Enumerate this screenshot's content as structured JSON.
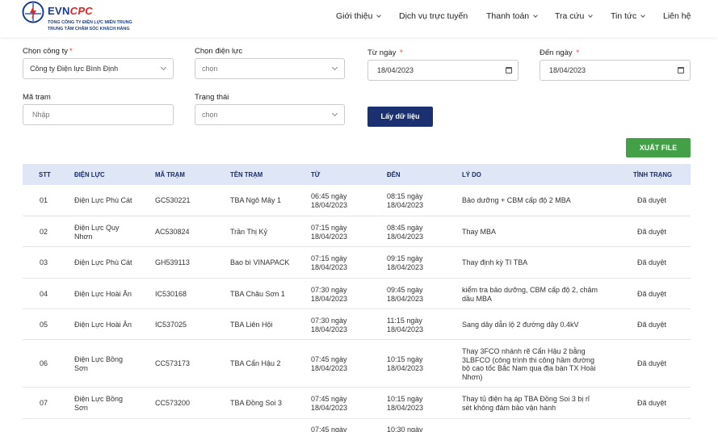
{
  "header": {
    "brand_evn": "EVN",
    "brand_cpc": "CPC",
    "line1": "TỔNG CÔNG TY ĐIỆN LỰC MIỀN TRUNG",
    "line2": "TRUNG TÂM CHĂM SÓC KHÁCH HÀNG",
    "nav": [
      {
        "label": "Giới thiệu",
        "dropdown": true
      },
      {
        "label": "Dịch vụ trực tuyến",
        "dropdown": false
      },
      {
        "label": "Thanh toán",
        "dropdown": true
      },
      {
        "label": "Tra cứu",
        "dropdown": true
      },
      {
        "label": "Tin tức",
        "dropdown": true
      },
      {
        "label": "Liên hệ",
        "dropdown": false
      }
    ]
  },
  "filters": {
    "company_label": "Chọn công ty",
    "company_value": "Công ty Điện lực Bình Định",
    "branch_label": "Chọn điện lực",
    "branch_value": "chọn",
    "from_label": "Từ ngày",
    "from_value": "18/04/2023",
    "to_label": "Đến ngày",
    "to_value": "18/04/2023",
    "station_label": "Mã trạm",
    "station_placeholder": "Nhập",
    "status_label": "Trạng thái",
    "status_value": "chọn",
    "get_button": "Lấy dữ liệu",
    "export_button": "XUẤT FILE"
  },
  "table": {
    "headers": [
      "STT",
      "ĐIỆN LỰC",
      "MÃ TRẠM",
      "TÊN TRẠM",
      "TỪ",
      "ĐẾN",
      "LÝ DO",
      "TÌNH TRẠNG"
    ],
    "rows": [
      {
        "stt": "01",
        "dl": [
          "Điện Lực Phù Cát"
        ],
        "ma": "GC530221",
        "ten": "TBA Ngô Mây 1",
        "tu": [
          "06:45 ngày",
          "18/04/2023"
        ],
        "den": [
          "08:15 ngày",
          "18/04/2023"
        ],
        "ly": [
          "Bảo dưỡng + CBM cấp độ 2 MBA"
        ],
        "tt": "Đã duyệt"
      },
      {
        "stt": "02",
        "dl": [
          "Điện Lực Quy",
          "Nhơn"
        ],
        "ma": "AC530824",
        "ten": "Trần Thị Kỷ",
        "tu": [
          "07:15 ngày",
          "18/04/2023"
        ],
        "den": [
          "08:45 ngày",
          "18/04/2023"
        ],
        "ly": [
          "Thay MBA"
        ],
        "tt": "Đã duyệt"
      },
      {
        "stt": "03",
        "dl": [
          "Điện Lực Phù Cát"
        ],
        "ma": "GH539113",
        "ten": "Bao bì VINAPACK",
        "tu": [
          "07:15 ngày",
          "18/04/2023"
        ],
        "den": [
          "09:15 ngày",
          "18/04/2023"
        ],
        "ly": [
          "Thay định kỳ TI TBA"
        ],
        "tt": "Đã duyệt"
      },
      {
        "stt": "04",
        "dl": [
          "Điện Lực Hoài Ân"
        ],
        "ma": "IC530168",
        "ten": "TBA Châu Sơn 1",
        "tu": [
          "07:30 ngày",
          "18/04/2023"
        ],
        "den": [
          "09:45 ngày",
          "18/04/2023"
        ],
        "ly": [
          "kiểm tra bảo dưỡng, CBM cấp độ 2, châm",
          "dầu MBA"
        ],
        "tt": "Đã duyệt"
      },
      {
        "stt": "05",
        "dl": [
          "Điện Lực Hoài Ân"
        ],
        "ma": "IC537025",
        "ten": "TBA Liên Hội",
        "tu": [
          "07:30 ngày",
          "18/04/2023"
        ],
        "den": [
          "11:15 ngày",
          "18/04/2023"
        ],
        "ly": [
          "Sang dây dẫn lộ 2 đường dây 0.4kV"
        ],
        "tt": "Đã duyệt"
      },
      {
        "stt": "06",
        "dl": [
          "Điện Lực Bồng",
          "Sơn"
        ],
        "ma": "CC573173",
        "ten": "TBA Cẩn Hậu 2",
        "tu": [
          "07:45 ngày",
          "18/04/2023"
        ],
        "den": [
          "10:15 ngày",
          "18/04/2023"
        ],
        "ly": [
          "Thay 3FCO nhánh rẽ Cẩn Hậu 2 bằng",
          "3LBFCO (công trình thi công hầm đường",
          "bộ cao tốc Bắc Nam qua địa bàn TX Hoài",
          "Nhơn)"
        ],
        "tt": "Đã duyệt"
      },
      {
        "stt": "07",
        "dl": [
          "Điện Lực Bồng",
          "Sơn"
        ],
        "ma": "CC573200",
        "ten": "TBA Đồng Soi 3",
        "tu": [
          "07:45 ngày",
          "18/04/2023"
        ],
        "den": [
          "10:15 ngày",
          "18/04/2023"
        ],
        "ly": [
          "Thay tủ điện hạ áp TBA Đồng Soi 3 bị rỉ",
          "sét không đảm bảo vận hành"
        ],
        "tt": "Đã duyệt"
      },
      {
        "stt": "",
        "dl": [
          ""
        ],
        "ma": "",
        "ten": "",
        "tu": [
          "07:45 ngày"
        ],
        "den": [
          "10:30 ngày"
        ],
        "ly": [
          ""
        ],
        "tt": ""
      }
    ]
  }
}
